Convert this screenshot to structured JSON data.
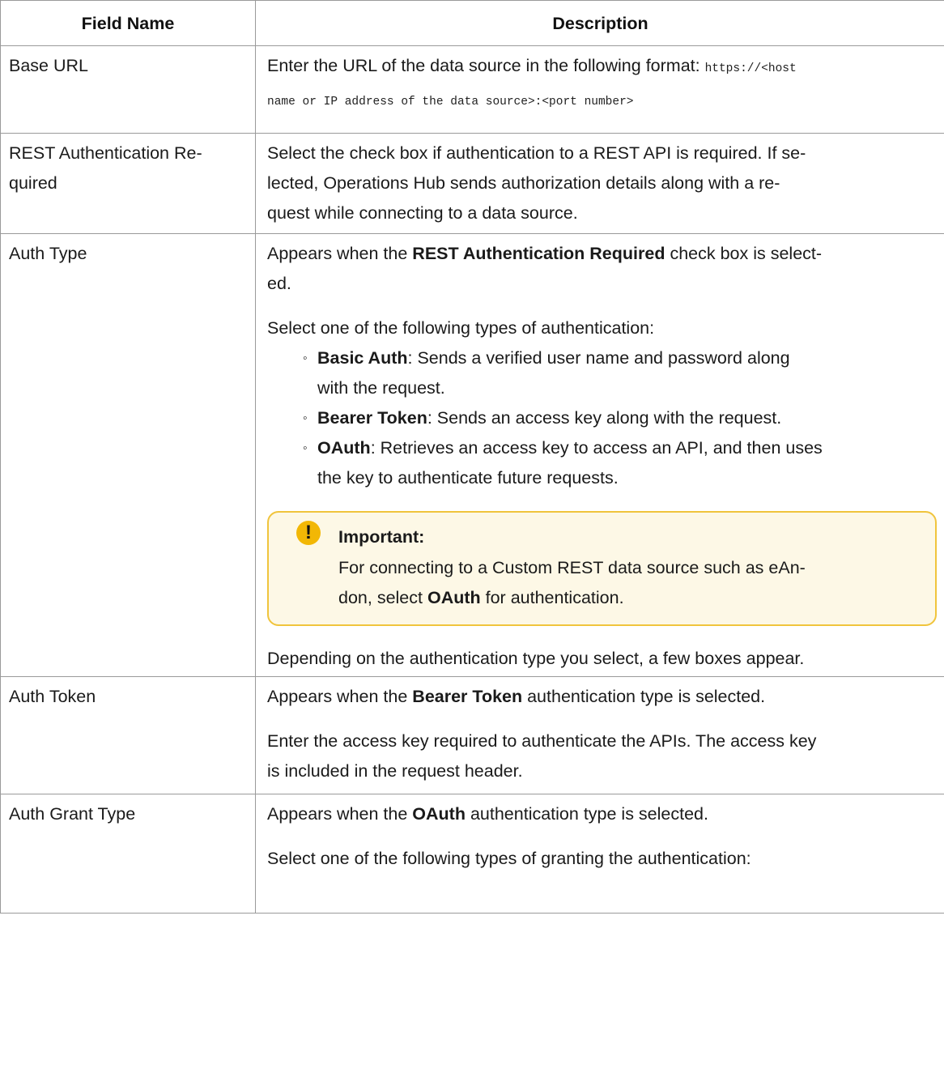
{
  "table": {
    "headers": {
      "field_name": "Field Name",
      "description": "Description"
    },
    "base_url": {
      "name": "Base URL",
      "desc_prefix": "Enter the URL of the data source in the following format: ",
      "desc_code_1": "https://<host",
      "desc_code_2": "name or IP address of the data source>:<port number>"
    },
    "rest_auth": {
      "name_1": "REST Authentication Re-",
      "name_2": "quired",
      "desc_1": "Select the check box if authentication to a REST API is required. If se-",
      "desc_2": "lected, Operations Hub sends authorization details along with a re-",
      "desc_3": "quest while connecting to a data source."
    },
    "auth_type": {
      "name": "Auth Type",
      "appears_prefix": "Appears when the ",
      "appears_bold": "REST Authentication Required",
      "appears_suffix_1": " check box is select-",
      "appears_suffix_2": "ed.",
      "select_intro": "Select one of the following types of authentication:",
      "options": [
        {
          "bullet": "◦",
          "label": "Basic Auth",
          "text_1": ": Sends a verified user name and password along",
          "text_2": "with the request."
        },
        {
          "bullet": "◦",
          "label": "Bearer Token",
          "text_1": ": Sends an access key along with the request.",
          "text_2": ""
        },
        {
          "bullet": "◦",
          "label": "OAuth",
          "text_1": ": Retrieves an access key to access an API, and then uses",
          "text_2": "the key to authenticate future requests."
        }
      ],
      "note": {
        "icon": "!",
        "title": "Important:",
        "text_1": "For connecting to a Custom REST data source such as eAn-",
        "text_2_prefix": "don, select ",
        "text_2_bold": "OAuth",
        "text_2_suffix": " for authentication."
      },
      "depending": "Depending on the authentication type you select, a few boxes appear."
    },
    "auth_token": {
      "name": "Auth Token",
      "appears_prefix": "Appears when the ",
      "appears_bold": "Bearer Token",
      "appears_suffix": " authentication type is selected.",
      "desc_1": "Enter the access key required to authenticate the APIs. The access key",
      "desc_2": "is included in the request header."
    },
    "auth_grant_type": {
      "name": "Auth Grant Type",
      "appears_prefix": "Appears when the ",
      "appears_bold": "OAuth",
      "appears_suffix": " authentication type is selected.",
      "select_intro": "Select one of the following types of granting the authentication:"
    }
  },
  "colors": {
    "border": "#9a9a9a",
    "note_border": "#f0c43c",
    "note_bg": "#fdf8e6",
    "note_icon": "#f2b705"
  }
}
